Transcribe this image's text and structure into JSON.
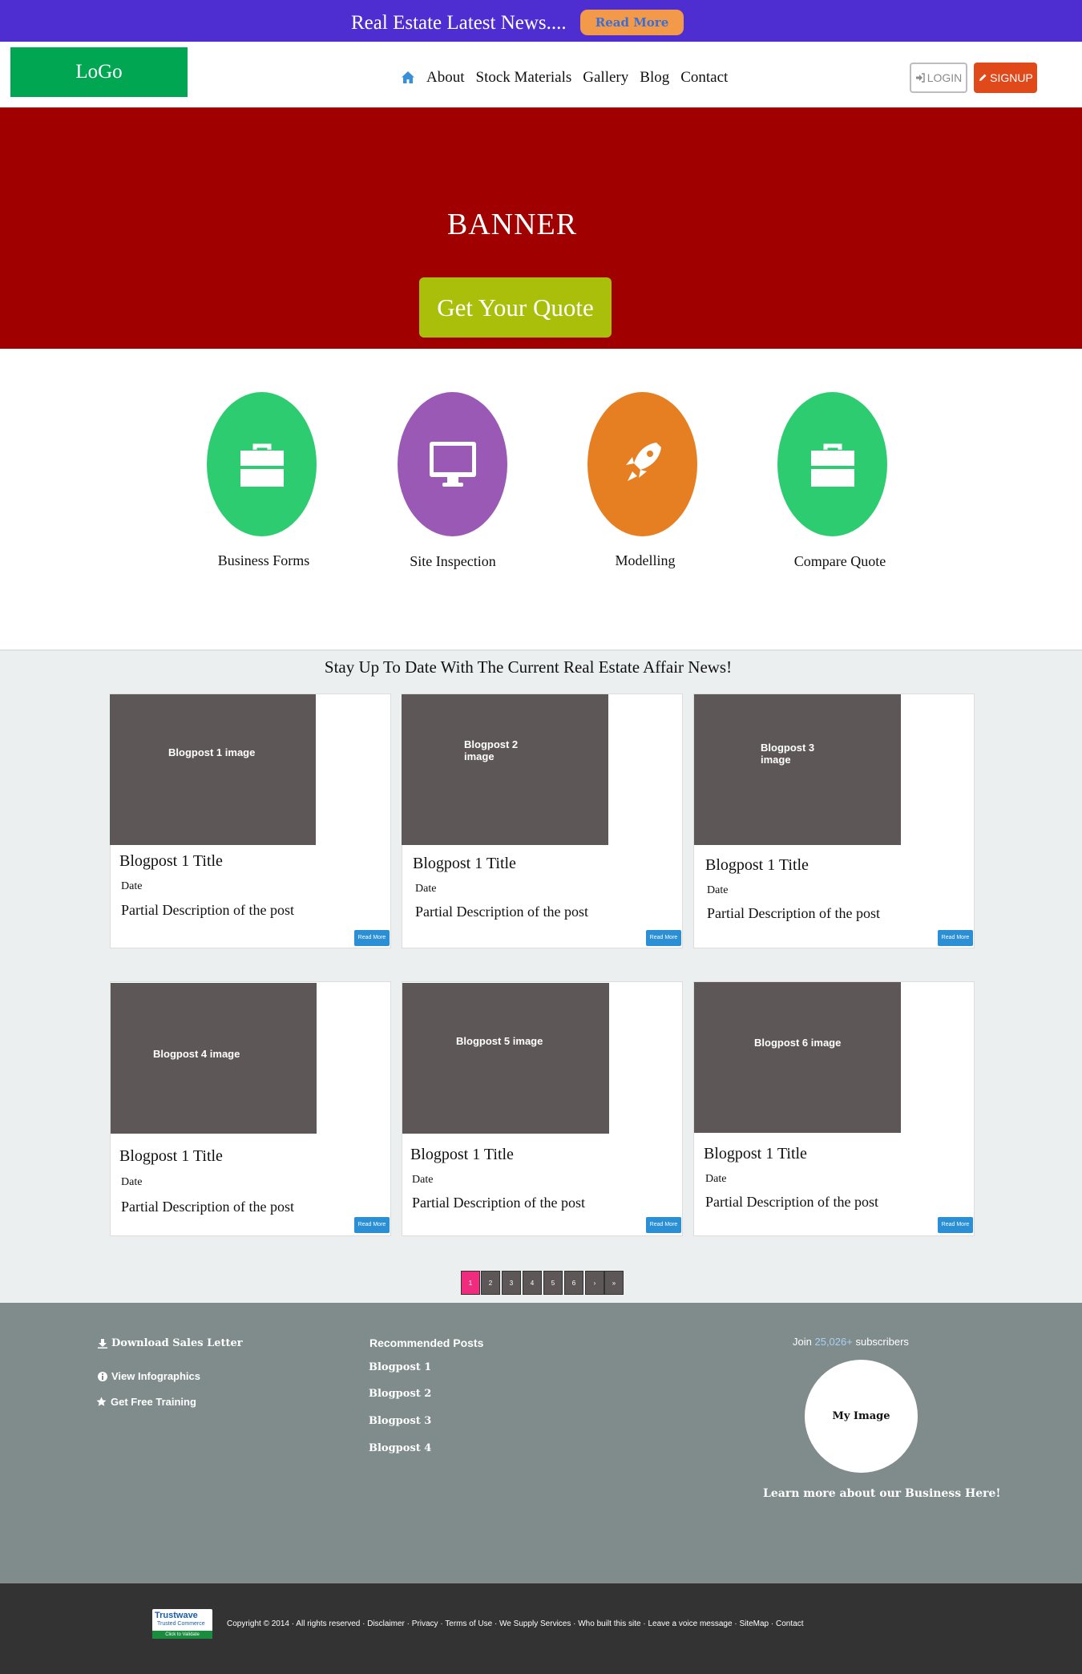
{
  "top_bar": {
    "news_text": "Real Estate Latest News....",
    "read_more": "Read More"
  },
  "header": {
    "logo": "LoGo",
    "nav": [
      "About",
      "Stock Materials",
      "Gallery",
      "Blog",
      "Contact"
    ],
    "login": "LOGIN",
    "signup": "SIGNUP"
  },
  "banner": {
    "title": "BANNER",
    "cta": "Get Your Quote"
  },
  "services": [
    {
      "label": "Business Forms",
      "icon": "briefcase-icon",
      "color": "#2ecc71"
    },
    {
      "label": "Site Inspection",
      "icon": "monitor-icon",
      "color": "#9b59b6"
    },
    {
      "label": "Modelling",
      "icon": "rocket-icon",
      "color": "#e67e22"
    },
    {
      "label": "Compare Quote",
      "icon": "briefcase-icon",
      "color": "#2ecc71"
    }
  ],
  "news": {
    "heading": "Stay Up To Date With The Current Real Estate Affair News!",
    "posts": [
      {
        "image_text": "Blogpost 1 image",
        "title": "Blogpost 1 Title",
        "date": "Date",
        "description": "Partial Description of the post",
        "read_more": "Read More"
      },
      {
        "image_text": "Blogpost 2 image",
        "title": "Blogpost 1 Title",
        "date": "Date",
        "description": "Partial Description of the post",
        "read_more": "Read More"
      },
      {
        "image_text": "Blogpost 3 image",
        "title": "Blogpost 1 Title",
        "date": "Date",
        "description": "Partial Description of the post",
        "read_more": "Read More"
      },
      {
        "image_text": "Blogpost 4 image",
        "title": "Blogpost 1 Title",
        "date": "Date",
        "description": "Partial Description of the post",
        "read_more": "Read More"
      },
      {
        "image_text": "Blogpost 5 image",
        "title": "Blogpost 1 Title",
        "date": "Date",
        "description": "Partial Description of the post",
        "read_more": "Read More"
      },
      {
        "image_text": "Blogpost 6 image",
        "title": "Blogpost 1 Title",
        "date": "Date",
        "description": "Partial Description of the post",
        "read_more": "Read More"
      }
    ]
  },
  "pagination": {
    "pages": [
      "1",
      "2",
      "3",
      "4",
      "5",
      "6",
      "›",
      "»"
    ],
    "active": "1"
  },
  "footer": {
    "left_links": [
      "Download Sales Letter",
      "View Infographics",
      "Get Free Training"
    ],
    "recommended_heading": "Recommended Posts",
    "recommended": [
      "Blogpost 1",
      "Blogpost 2",
      "Blogpost 3",
      "Blogpost 4"
    ],
    "subscribe_prefix": "Join",
    "subscriber_count": "25,026+",
    "subscribe_suffix": "subscribers",
    "my_image": "My Image",
    "learn_more": "Learn more about our Business Here!"
  },
  "bottom": {
    "badge_brand": "Trustwave",
    "badge_sub": "Trusted Commerce",
    "badge_cta": "Click to Validate",
    "copyright": "Copyright © 2014 ·  All rights reserved · Disclaimer · Privacy · Terms of Use · We Supply Services · Who built this site · Leave a voice message · SiteMap · Contact"
  }
}
